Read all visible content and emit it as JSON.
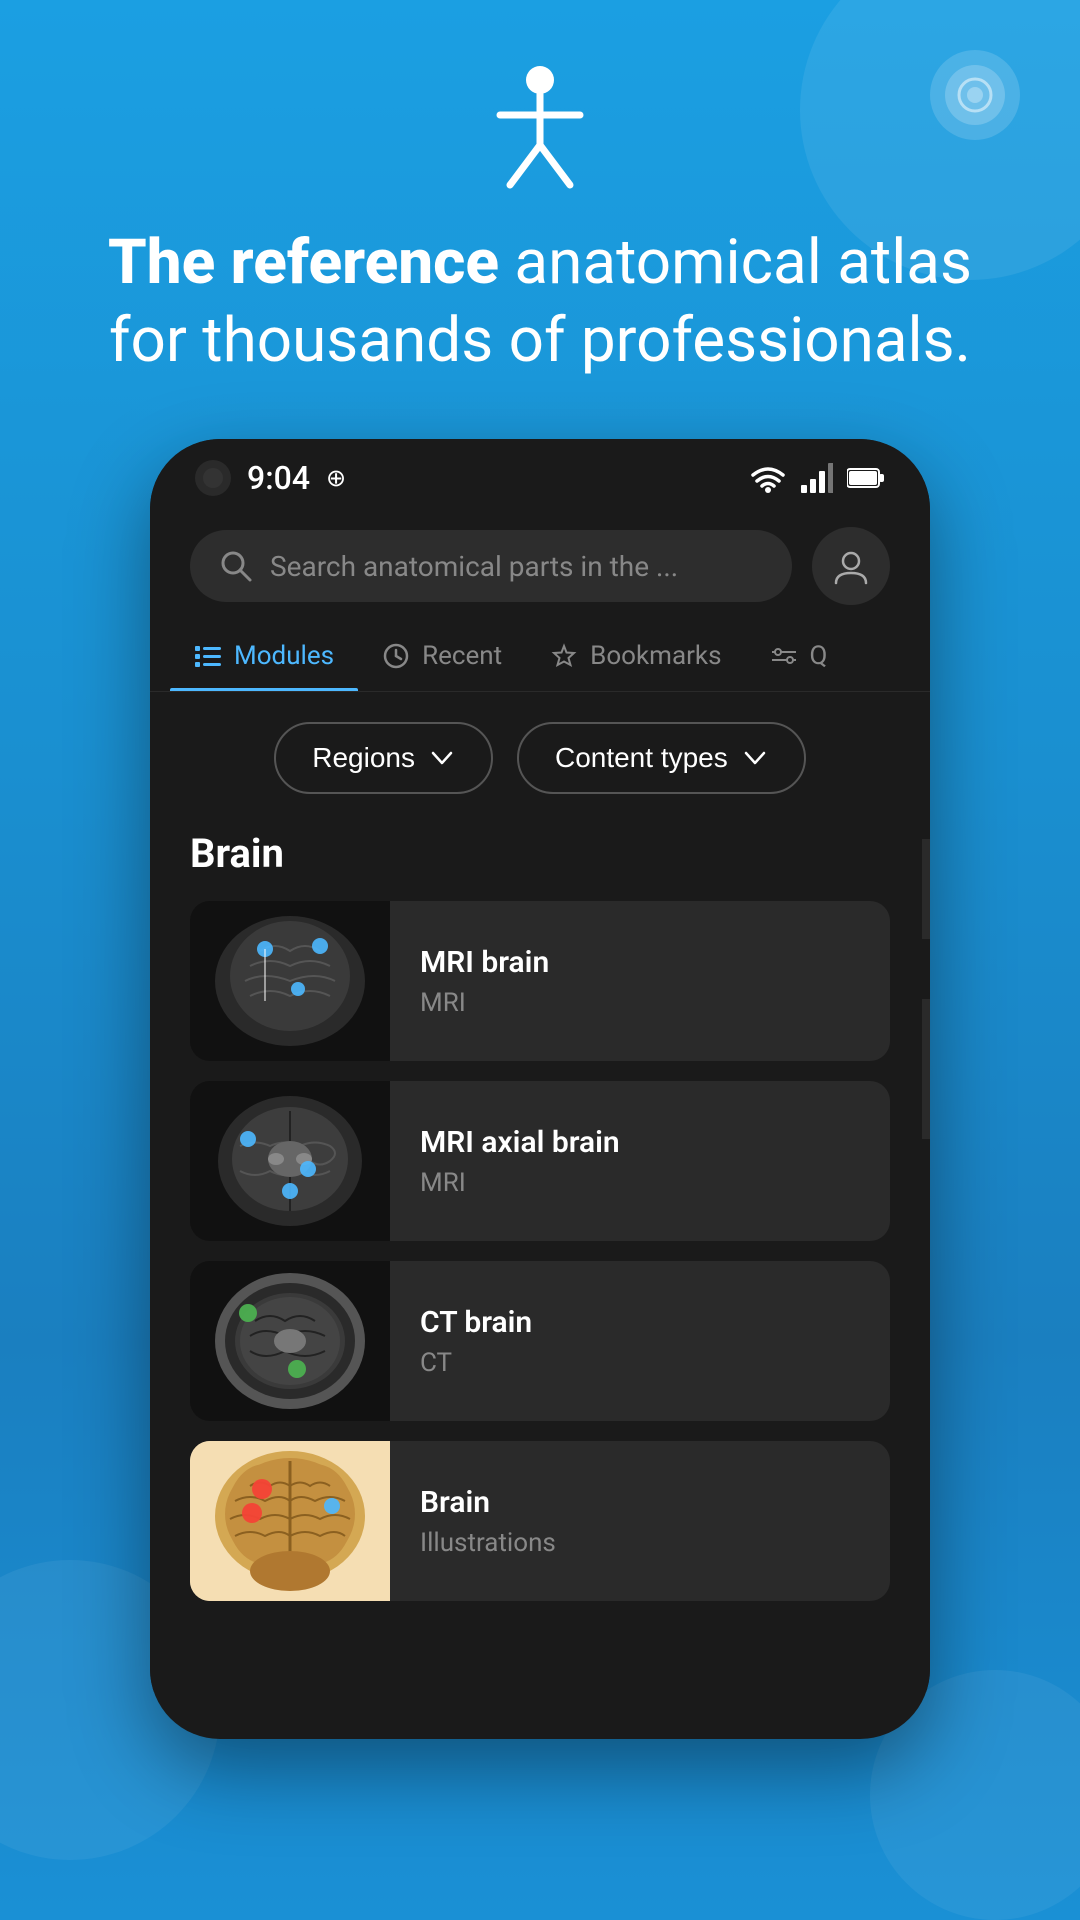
{
  "app": {
    "hero": {
      "title_bold": "The reference",
      "title_rest": " anatomical atlas for thousands of professionals."
    },
    "notification_icon": "notification-bell"
  },
  "status_bar": {
    "time": "9:04",
    "icons": [
      "wifi",
      "signal",
      "battery"
    ]
  },
  "search": {
    "placeholder": "Search anatomical parts in the ...",
    "profile_icon": "user-profile"
  },
  "navigation": {
    "tabs": [
      {
        "id": "modules",
        "label": "Modules",
        "icon": "modules-icon",
        "active": true
      },
      {
        "id": "recent",
        "label": "Recent",
        "icon": "clock-icon",
        "active": false
      },
      {
        "id": "bookmarks",
        "label": "Bookmarks",
        "icon": "star-icon",
        "active": false
      },
      {
        "id": "filter",
        "label": "Q",
        "icon": "filter-icon",
        "active": false
      }
    ]
  },
  "filters": {
    "regions_label": "Regions",
    "content_types_label": "Content types"
  },
  "sections": [
    {
      "heading": "Brain",
      "items": [
        {
          "id": "mri-brain",
          "title": "MRI brain",
          "subtitle": "MRI",
          "thumb_type": "mri-sagittal"
        },
        {
          "id": "mri-axial-brain",
          "title": "MRI axial brain",
          "subtitle": "MRI",
          "thumb_type": "mri-axial"
        },
        {
          "id": "ct-brain",
          "title": "CT brain",
          "subtitle": "CT",
          "thumb_type": "ct"
        },
        {
          "id": "brain-illustration",
          "title": "Brain",
          "subtitle": "Illustrations",
          "thumb_type": "illustration"
        }
      ]
    }
  ]
}
